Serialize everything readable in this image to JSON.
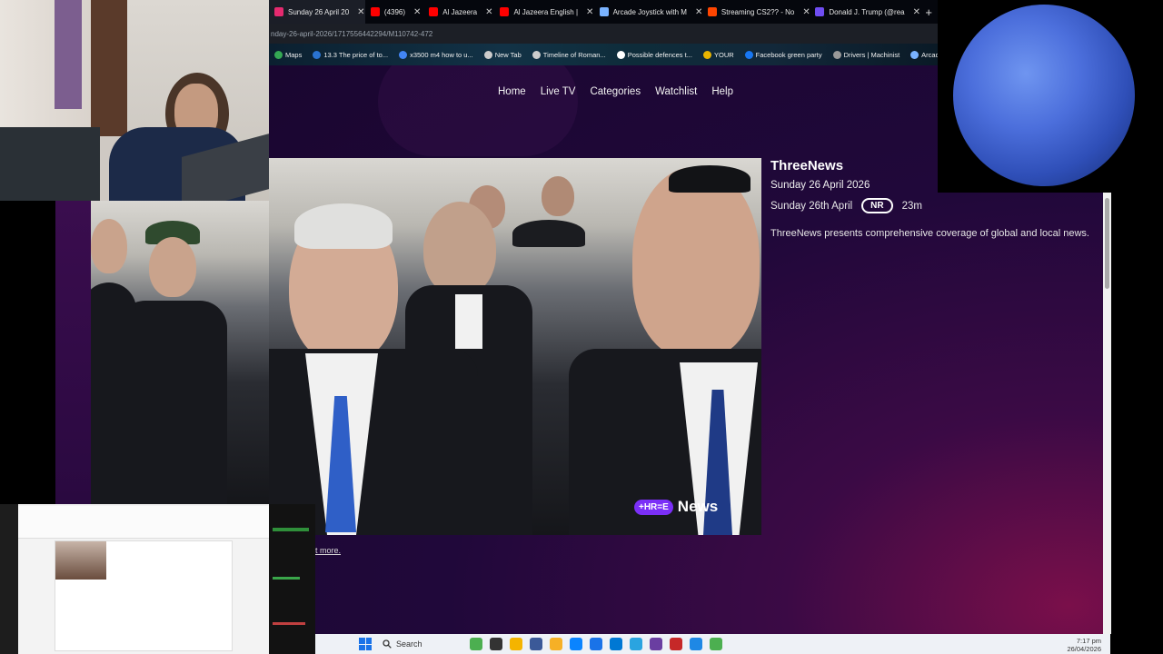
{
  "tabs": [
    {
      "label": "Sunday 26 April 20",
      "color": "#e52a6f",
      "active": true
    },
    {
      "label": "(4396)",
      "color": "#ff0000"
    },
    {
      "label": "Al Jazeera",
      "color": "#ff0000"
    },
    {
      "label": "Al Jazeera English |",
      "color": "#ff0000"
    },
    {
      "label": "Arcade Joystick with M",
      "color": "#7ab3ff"
    },
    {
      "label": "Streaming CS2?? - No",
      "color": "#ff4500"
    },
    {
      "label": "Donald J. Trump (@rea",
      "color": "#6f4df2"
    }
  ],
  "new_tab_glyph": "+",
  "url": "nday-26-april-2026/1717556442294/M110742-472",
  "bookmarks": [
    {
      "label": "Maps",
      "color": "#34a853"
    },
    {
      "label": "13.3 The price of to...",
      "color": "#2a73d0"
    },
    {
      "label": "x3500 m4 how to u...",
      "color": "#4285f4"
    },
    {
      "label": "New Tab",
      "color": "#cccccc"
    },
    {
      "label": "Timeline of Roman...",
      "color": "#cccccc"
    },
    {
      "label": "Possible defences t...",
      "color": "#ffffff"
    },
    {
      "label": "YOUR",
      "color": "#e8b400"
    },
    {
      "label": "Facebook green party",
      "color": "#1877f2"
    },
    {
      "label": "Drivers | Machinist",
      "color": "#999999"
    },
    {
      "label": "Arcade Joystick w",
      "color": "#7ab3ff"
    }
  ],
  "nav": [
    "Home",
    "Live TV",
    "Categories",
    "Watchlist",
    "Help"
  ],
  "info": {
    "title": "ThreeNews",
    "date": "Sunday 26 April 2026",
    "airdate": "Sunday 26th April",
    "rating": "NR",
    "duration": "23m",
    "description": "ThreeNews presents comprehensive coverage of global and local news."
  },
  "logo": {
    "pill": "+HR=E",
    "word": "News"
  },
  "read_more": "t more.",
  "taskbar": {
    "search": "Search",
    "time": "7:17 pm",
    "date": "26/04/2026",
    "app_colors": [
      "#4caf50",
      "#333333",
      "#f4b400",
      "#3b5998",
      "#f6b026",
      "#0a84ff",
      "#1a73e8",
      "#0078d4",
      "#2aa4e0",
      "#6a3ea1",
      "#c62828",
      "#1e88e5",
      "#4caf50"
    ]
  }
}
